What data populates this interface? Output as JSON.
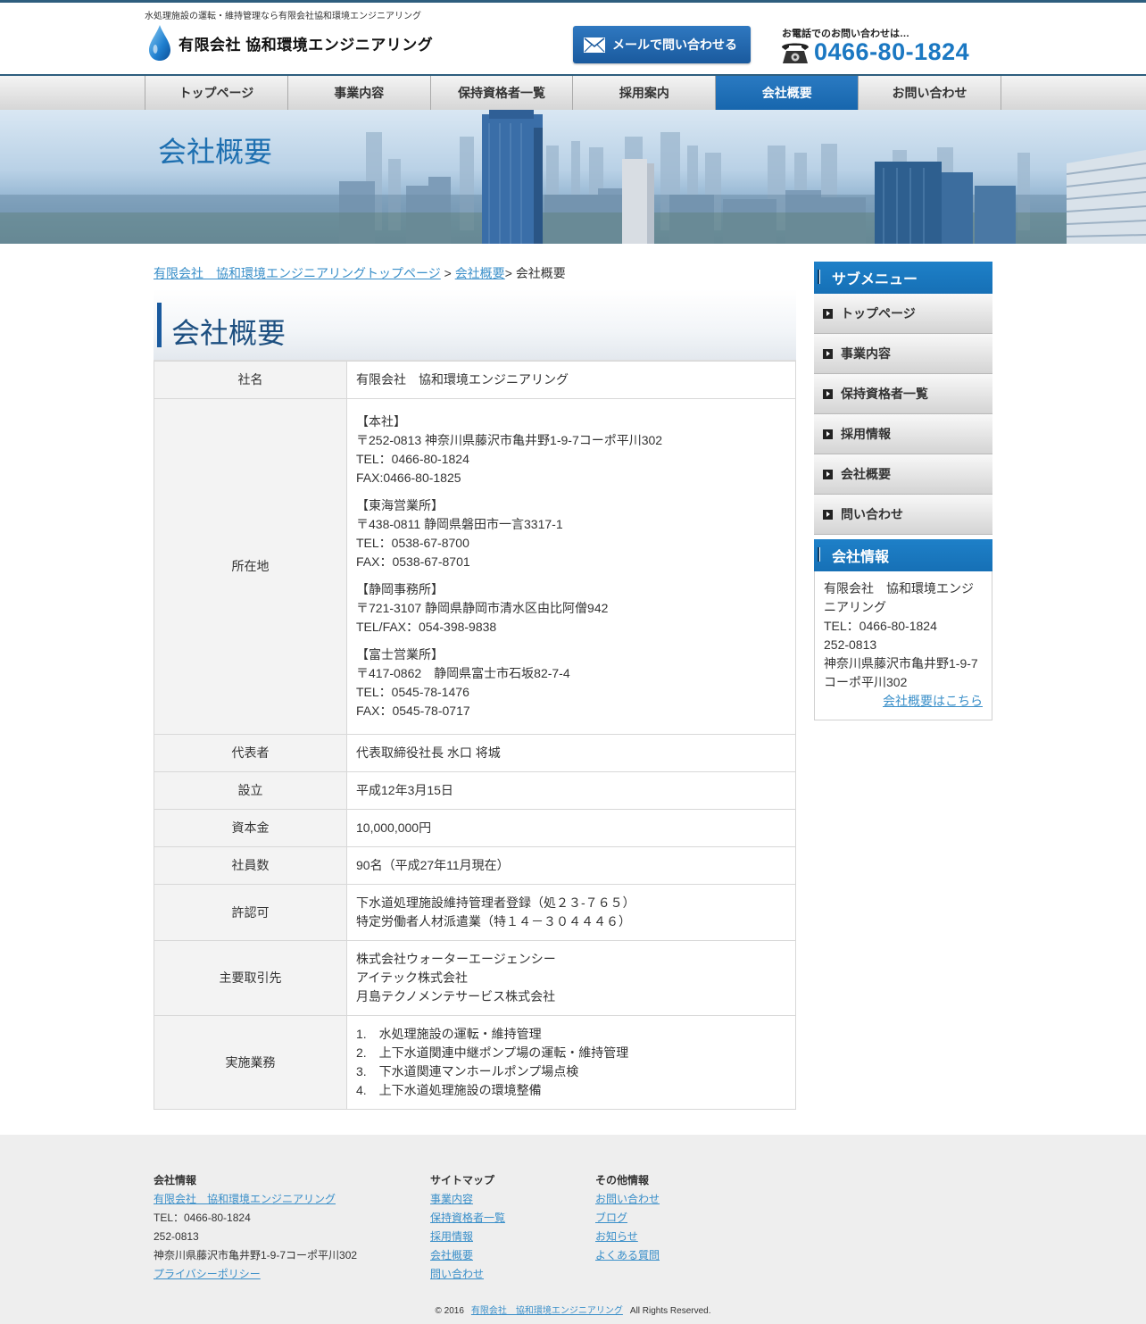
{
  "header": {
    "tagline": "水処理施設の運転・維持管理なら有限会社協和環境エンジニアリング",
    "logo_text": "有限会社 協和環境エンジニアリング",
    "mail_button": "メールで問い合わせる",
    "tel_label": "お電話でのお問い合わせは…",
    "tel_number": "0466-80-1824"
  },
  "nav": [
    "トップページ",
    "事業内容",
    "保持資格者一覧",
    "採用案内",
    "会社概要",
    "お問い合わせ"
  ],
  "hero_title": "会社概要",
  "breadcrumb": {
    "home": "有限会社　協和環境エンジニアリングトップページ",
    "sep1": " > ",
    "section": "会社概要",
    "sep2": "> ",
    "current": "会社概要"
  },
  "page_heading": "会社概要",
  "company": {
    "name_label": "社名",
    "name_value": "有限会社　協和環境エンジニアリング",
    "location_label": "所在地",
    "offices": [
      [
        "【本社】",
        "〒252-0813 神奈川県藤沢市亀井野1-9-7コーポ平川302",
        "TEL：0466-80-1824",
        "FAX:0466-80-1825"
      ],
      [
        "【東海営業所】",
        "〒438-0811 静岡県磐田市一言3317-1",
        "TEL：0538-67-8700",
        "FAX：0538-67-8701"
      ],
      [
        "【静岡事務所】",
        "〒721-3107 静岡県静岡市清水区由比阿僧942",
        "TEL/FAX：054-398-9838"
      ],
      [
        "【富士営業所】",
        "〒417-0862　静岡県富士市石坂82-7-4",
        "TEL：0545-78-1476",
        "FAX：0545-78-0717"
      ]
    ],
    "rep_label": "代表者",
    "rep_value": "代表取締役社長 水口 将城",
    "founded_label": "設立",
    "founded_value": "平成12年3月15日",
    "capital_label": "資本金",
    "capital_value": "10,000,000円",
    "employees_label": "社員数",
    "employees_value": "90名（平成27年11月現在）",
    "license_label": "許認可",
    "license_values": [
      "下水道処理施設維持管理者登録（処２３-７６５）",
      "特定労働者人材派遣業（特１４－３０４４４６）"
    ],
    "clients_label": "主要取引先",
    "clients_values": [
      "株式会社ウォーターエージェンシー",
      "アイテック株式会社",
      "月島テクノメンテサービス株式会社"
    ],
    "work_label": "実施業務",
    "work_values": [
      "1.　水処理施設の運転・維持管理",
      "2.　上下水道関連中継ポンプ場の運転・維持管理",
      "3.　下水道関連マンホールポンプ場点検",
      "4.　上下水道処理施設の環境整備"
    ]
  },
  "sidebar": {
    "submenu_title": "サブメニュー",
    "submenu": [
      "トップページ",
      "事業内容",
      "保持資格者一覧",
      "採用情報",
      "会社概要",
      "問い合わせ"
    ],
    "info_title": "会社情報",
    "info_lines": [
      "有限会社　協和環境エンジニアリング",
      "TEL：0466-80-1824",
      "252-0813",
      "神奈川県藤沢市亀井野1-9-7コーポ平川302"
    ],
    "info_link": "会社概要はこちら"
  },
  "footer": {
    "col1_title": "会社情報",
    "col1_company": "有限会社　協和環境エンジニアリング",
    "col1_tel": "TEL：0466-80-1824",
    "col1_zip": "252-0813",
    "col1_address": "神奈川県藤沢市亀井野1-9-7コーポ平川302",
    "col1_privacy": "プライバシーポリシー",
    "col2_title": "サイトマップ",
    "col2_links": [
      "事業内容",
      "保持資格者一覧",
      "採用情報",
      "会社概要",
      "問い合わせ"
    ],
    "col3_title": "その他情報",
    "col3_links": [
      "お問い合わせ",
      "ブログ",
      "お知らせ",
      "よくある質問"
    ],
    "copyright_prefix": "© 2016",
    "copyright_company": "有限会社　協和環境エンジニアリング",
    "copyright_suffix": "All Rights Reserved."
  },
  "colors": {
    "accent": "#1a5a9e",
    "link": "#3a8fc9",
    "nav_active": "#2a7ac2",
    "tel": "#1b78c2"
  }
}
